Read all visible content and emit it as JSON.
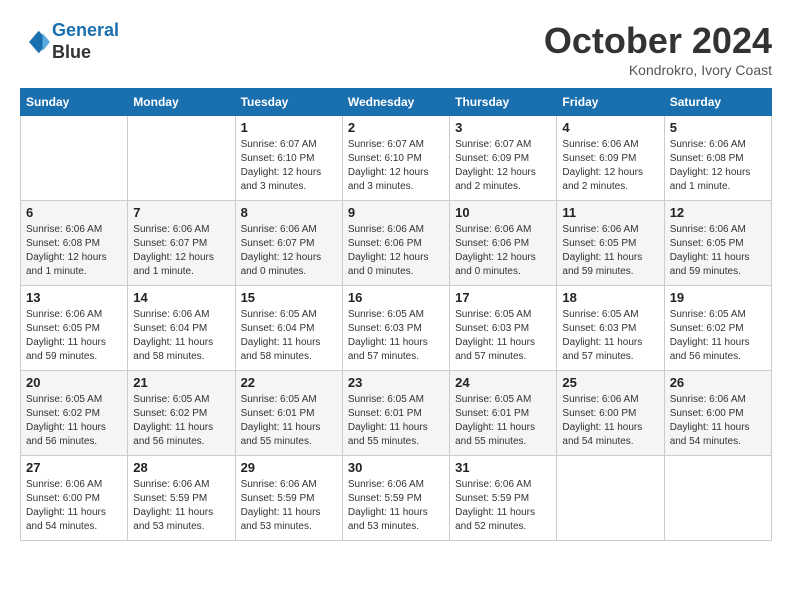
{
  "header": {
    "logo_line1": "General",
    "logo_line2": "Blue",
    "month": "October 2024",
    "location": "Kondrokro, Ivory Coast"
  },
  "weekdays": [
    "Sunday",
    "Monday",
    "Tuesday",
    "Wednesday",
    "Thursday",
    "Friday",
    "Saturday"
  ],
  "weeks": [
    [
      {
        "day": "",
        "info": ""
      },
      {
        "day": "",
        "info": ""
      },
      {
        "day": "1",
        "info": "Sunrise: 6:07 AM\nSunset: 6:10 PM\nDaylight: 12 hours and 3 minutes."
      },
      {
        "day": "2",
        "info": "Sunrise: 6:07 AM\nSunset: 6:10 PM\nDaylight: 12 hours and 3 minutes."
      },
      {
        "day": "3",
        "info": "Sunrise: 6:07 AM\nSunset: 6:09 PM\nDaylight: 12 hours and 2 minutes."
      },
      {
        "day": "4",
        "info": "Sunrise: 6:06 AM\nSunset: 6:09 PM\nDaylight: 12 hours and 2 minutes."
      },
      {
        "day": "5",
        "info": "Sunrise: 6:06 AM\nSunset: 6:08 PM\nDaylight: 12 hours and 1 minute."
      }
    ],
    [
      {
        "day": "6",
        "info": "Sunrise: 6:06 AM\nSunset: 6:08 PM\nDaylight: 12 hours and 1 minute."
      },
      {
        "day": "7",
        "info": "Sunrise: 6:06 AM\nSunset: 6:07 PM\nDaylight: 12 hours and 1 minute."
      },
      {
        "day": "8",
        "info": "Sunrise: 6:06 AM\nSunset: 6:07 PM\nDaylight: 12 hours and 0 minutes."
      },
      {
        "day": "9",
        "info": "Sunrise: 6:06 AM\nSunset: 6:06 PM\nDaylight: 12 hours and 0 minutes."
      },
      {
        "day": "10",
        "info": "Sunrise: 6:06 AM\nSunset: 6:06 PM\nDaylight: 12 hours and 0 minutes."
      },
      {
        "day": "11",
        "info": "Sunrise: 6:06 AM\nSunset: 6:05 PM\nDaylight: 11 hours and 59 minutes."
      },
      {
        "day": "12",
        "info": "Sunrise: 6:06 AM\nSunset: 6:05 PM\nDaylight: 11 hours and 59 minutes."
      }
    ],
    [
      {
        "day": "13",
        "info": "Sunrise: 6:06 AM\nSunset: 6:05 PM\nDaylight: 11 hours and 59 minutes."
      },
      {
        "day": "14",
        "info": "Sunrise: 6:06 AM\nSunset: 6:04 PM\nDaylight: 11 hours and 58 minutes."
      },
      {
        "day": "15",
        "info": "Sunrise: 6:05 AM\nSunset: 6:04 PM\nDaylight: 11 hours and 58 minutes."
      },
      {
        "day": "16",
        "info": "Sunrise: 6:05 AM\nSunset: 6:03 PM\nDaylight: 11 hours and 57 minutes."
      },
      {
        "day": "17",
        "info": "Sunrise: 6:05 AM\nSunset: 6:03 PM\nDaylight: 11 hours and 57 minutes."
      },
      {
        "day": "18",
        "info": "Sunrise: 6:05 AM\nSunset: 6:03 PM\nDaylight: 11 hours and 57 minutes."
      },
      {
        "day": "19",
        "info": "Sunrise: 6:05 AM\nSunset: 6:02 PM\nDaylight: 11 hours and 56 minutes."
      }
    ],
    [
      {
        "day": "20",
        "info": "Sunrise: 6:05 AM\nSunset: 6:02 PM\nDaylight: 11 hours and 56 minutes."
      },
      {
        "day": "21",
        "info": "Sunrise: 6:05 AM\nSunset: 6:02 PM\nDaylight: 11 hours and 56 minutes."
      },
      {
        "day": "22",
        "info": "Sunrise: 6:05 AM\nSunset: 6:01 PM\nDaylight: 11 hours and 55 minutes."
      },
      {
        "day": "23",
        "info": "Sunrise: 6:05 AM\nSunset: 6:01 PM\nDaylight: 11 hours and 55 minutes."
      },
      {
        "day": "24",
        "info": "Sunrise: 6:05 AM\nSunset: 6:01 PM\nDaylight: 11 hours and 55 minutes."
      },
      {
        "day": "25",
        "info": "Sunrise: 6:06 AM\nSunset: 6:00 PM\nDaylight: 11 hours and 54 minutes."
      },
      {
        "day": "26",
        "info": "Sunrise: 6:06 AM\nSunset: 6:00 PM\nDaylight: 11 hours and 54 minutes."
      }
    ],
    [
      {
        "day": "27",
        "info": "Sunrise: 6:06 AM\nSunset: 6:00 PM\nDaylight: 11 hours and 54 minutes."
      },
      {
        "day": "28",
        "info": "Sunrise: 6:06 AM\nSunset: 5:59 PM\nDaylight: 11 hours and 53 minutes."
      },
      {
        "day": "29",
        "info": "Sunrise: 6:06 AM\nSunset: 5:59 PM\nDaylight: 11 hours and 53 minutes."
      },
      {
        "day": "30",
        "info": "Sunrise: 6:06 AM\nSunset: 5:59 PM\nDaylight: 11 hours and 53 minutes."
      },
      {
        "day": "31",
        "info": "Sunrise: 6:06 AM\nSunset: 5:59 PM\nDaylight: 11 hours and 52 minutes."
      },
      {
        "day": "",
        "info": ""
      },
      {
        "day": "",
        "info": ""
      }
    ]
  ]
}
